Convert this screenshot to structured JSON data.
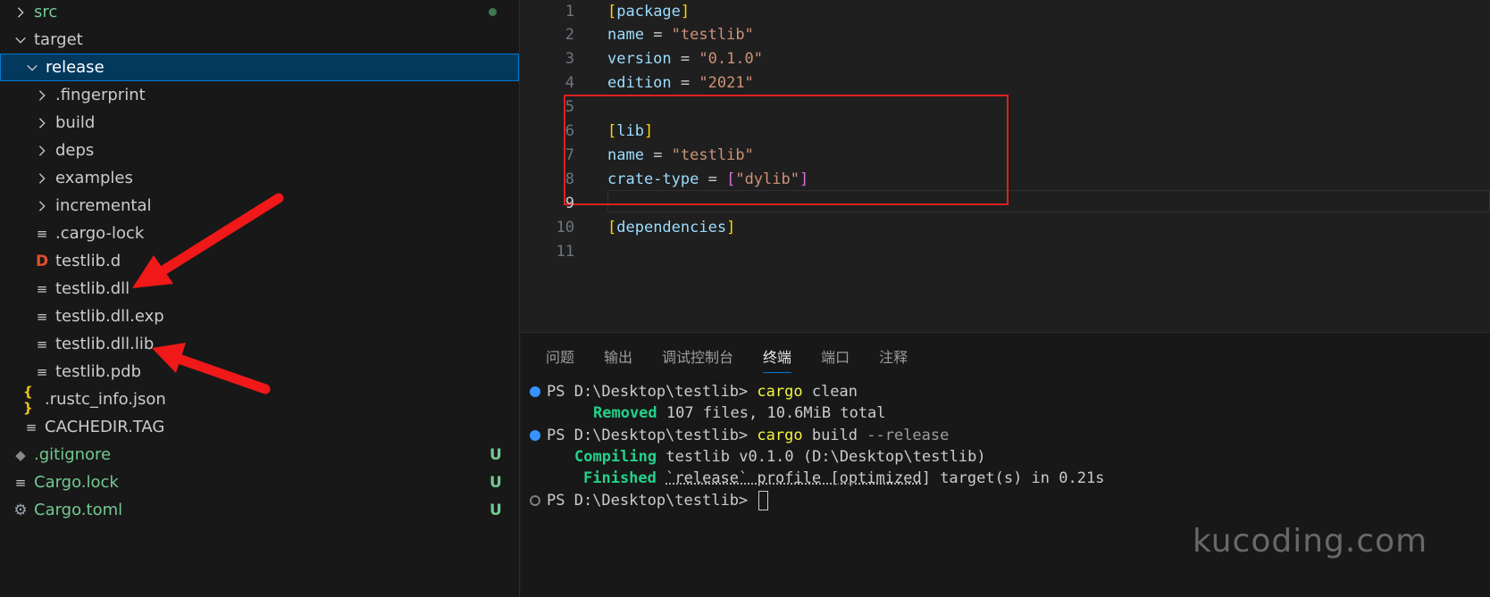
{
  "explorer": {
    "items": [
      {
        "label": "src",
        "type": "folder",
        "state": "collapsed",
        "indent": 1,
        "git": "dot"
      },
      {
        "label": "target",
        "type": "folder",
        "state": "expanded",
        "indent": 1
      },
      {
        "label": "release",
        "type": "folder",
        "state": "expanded",
        "indent": 2,
        "selected": true
      },
      {
        "label": ".fingerprint",
        "type": "folder",
        "state": "collapsed",
        "indent": 3
      },
      {
        "label": "build",
        "type": "folder",
        "state": "collapsed",
        "indent": 3
      },
      {
        "label": "deps",
        "type": "folder",
        "state": "collapsed",
        "indent": 3
      },
      {
        "label": "examples",
        "type": "folder",
        "state": "collapsed",
        "indent": 3
      },
      {
        "label": "incremental",
        "type": "folder",
        "state": "collapsed",
        "indent": 3
      },
      {
        "label": ".cargo-lock",
        "type": "file",
        "icon": "lines-icon",
        "indent": 3
      },
      {
        "label": "testlib.d",
        "type": "file",
        "icon": "d-file-icon",
        "indent": 3
      },
      {
        "label": "testlib.dll",
        "type": "file",
        "icon": "lines-icon",
        "indent": 3
      },
      {
        "label": "testlib.dll.exp",
        "type": "file",
        "icon": "lines-icon",
        "indent": 3
      },
      {
        "label": "testlib.dll.lib",
        "type": "file",
        "icon": "lines-icon",
        "indent": 3
      },
      {
        "label": "testlib.pdb",
        "type": "file",
        "icon": "lines-icon",
        "indent": 3
      },
      {
        "label": ".rustc_info.json",
        "type": "file",
        "icon": "json-icon",
        "indent": 2
      },
      {
        "label": "CACHEDIR.TAG",
        "type": "file",
        "icon": "lines-icon",
        "indent": 2
      },
      {
        "label": ".gitignore",
        "type": "file",
        "icon": "git-icon",
        "indent": 1,
        "git": "U"
      },
      {
        "label": "Cargo.lock",
        "type": "file",
        "icon": "lines-icon",
        "indent": 1,
        "git": "U"
      },
      {
        "label": "Cargo.toml",
        "type": "file",
        "icon": "gear-icon",
        "indent": 1,
        "git": "U"
      }
    ],
    "icons": {
      "d_glyph": "D",
      "json_glyph": "{ }",
      "untracked_badge": "U"
    }
  },
  "editor": {
    "lines": [
      {
        "n": "1",
        "parts": [
          [
            "br",
            "["
          ],
          [
            "sec",
            "package"
          ],
          [
            "br",
            "]"
          ]
        ]
      },
      {
        "n": "2",
        "parts": [
          [
            "key",
            "name"
          ],
          [
            "txt",
            " = "
          ],
          [
            "str",
            "\"testlib\""
          ]
        ]
      },
      {
        "n": "3",
        "parts": [
          [
            "key",
            "version"
          ],
          [
            "txt",
            " = "
          ],
          [
            "str",
            "\"0.1.0\""
          ]
        ]
      },
      {
        "n": "4",
        "parts": [
          [
            "key",
            "edition"
          ],
          [
            "txt",
            " = "
          ],
          [
            "str",
            "\"2021\""
          ]
        ]
      },
      {
        "n": "5",
        "parts": []
      },
      {
        "n": "6",
        "parts": [
          [
            "br",
            "["
          ],
          [
            "sec",
            "lib"
          ],
          [
            "br",
            "]"
          ]
        ]
      },
      {
        "n": "7",
        "parts": [
          [
            "key",
            "name"
          ],
          [
            "txt",
            " = "
          ],
          [
            "str",
            "\"testlib\""
          ]
        ]
      },
      {
        "n": "8",
        "parts": [
          [
            "key",
            "crate-type"
          ],
          [
            "txt",
            " = "
          ],
          [
            "br",
            "["
          ],
          [
            "str",
            "\"dylib\""
          ],
          [
            "br",
            "]"
          ]
        ]
      },
      {
        "n": "9",
        "parts": []
      },
      {
        "n": "10",
        "parts": [
          [
            "br",
            "["
          ],
          [
            "sec",
            "dependencies"
          ],
          [
            "br",
            "]"
          ]
        ]
      },
      {
        "n": "11",
        "parts": []
      }
    ]
  },
  "panel": {
    "tabs": [
      {
        "label": "问题"
      },
      {
        "label": "输出"
      },
      {
        "label": "调试控制台"
      },
      {
        "label": "终端",
        "active": true
      },
      {
        "label": "端口"
      },
      {
        "label": "注释"
      }
    ],
    "terminal": {
      "prompt": "PS D:\\Desktop\\testlib> ",
      "cmd1": "cargo",
      "cmd1_args": " clean",
      "removed_word": "Removed",
      "removed_rest": " 107 files, 10.6MiB total",
      "cmd2": "cargo",
      "cmd2_args": " build",
      "cmd2_flag": " --release",
      "compiling_word": "Compiling",
      "compiling_rest": " testlib v0.1.0 (D:\\Desktop\\testlib)",
      "finished_word": "Finished",
      "finished_profile": "`release` profile [optimized]",
      "finished_rest": " target(s) in 0.21s"
    }
  },
  "watermark": "kucoding.com",
  "colors": {
    "selection": "#04395e",
    "accent": "#0078d4",
    "git_untracked": "#73c991",
    "annotation_red": "#e02020"
  }
}
